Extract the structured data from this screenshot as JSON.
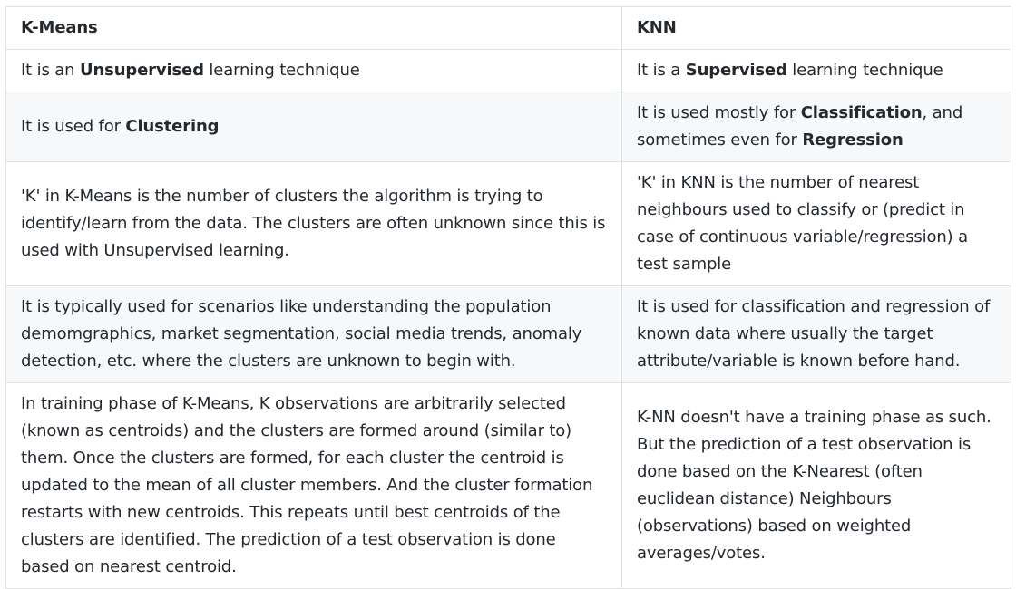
{
  "table": {
    "headers": [
      "K-Means",
      "KNN"
    ],
    "rows": [
      [
        [
          {
            "t": "It is an "
          },
          {
            "t": "Unsupervised",
            "b": true
          },
          {
            "t": " learning technique"
          }
        ],
        [
          {
            "t": "It is a "
          },
          {
            "t": "Supervised",
            "b": true
          },
          {
            "t": " learning technique"
          }
        ]
      ],
      [
        [
          {
            "t": "It is used for "
          },
          {
            "t": "Clustering",
            "b": true
          }
        ],
        [
          {
            "t": "It is used mostly for "
          },
          {
            "t": "Classification",
            "b": true
          },
          {
            "t": ", and sometimes even for "
          },
          {
            "t": "Regression",
            "b": true
          }
        ]
      ],
      [
        [
          {
            "t": "'K' in K-Means is the number of clusters the algorithm is trying to identify/learn from the data. The clusters are often unknown since this is used with Unsupervised learning."
          }
        ],
        [
          {
            "t": "'K' in KNN is the number of nearest neighbours used to classify or (predict in case of continuous variable/regression) a test sample"
          }
        ]
      ],
      [
        [
          {
            "t": "It is typically used for scenarios like understanding the population demomgraphics, market segmentation, social media trends, anomaly detection, etc. where the clusters are unknown to begin with."
          }
        ],
        [
          {
            "t": "It is used for classification and regression of known data where usually the target attribute/variable is known before hand."
          }
        ]
      ],
      [
        [
          {
            "t": "In training phase of K-Means, K observations are arbitrarily selected (known as centroids) and the clusters are formed around (similar to) them. Once the clusters are formed, for each cluster the centroid is updated to the mean of all cluster members. And the cluster formation restarts with new centroids. This repeats until best centroids of the clusters are identified. The prediction of a test observation is done based on nearest centroid."
          }
        ],
        [
          {
            "t": "K-NN doesn't have a training phase as such. But the prediction of a test observation is done based on the K-Nearest (often euclidean distance) Neighbours (observations) based on weighted averages/votes."
          }
        ]
      ]
    ]
  }
}
